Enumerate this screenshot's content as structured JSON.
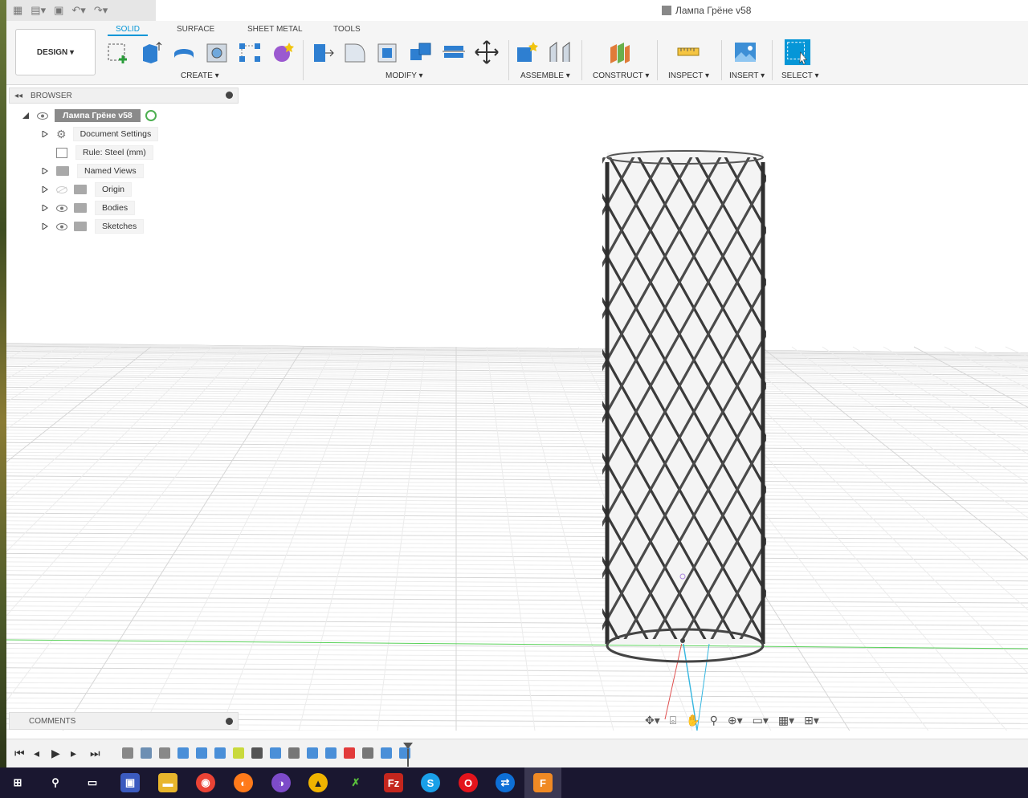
{
  "app": {
    "document_title": "Лампа Грёне v58",
    "workspace_button": "DESIGN ▾"
  },
  "tabs": [
    "SOLID",
    "SURFACE",
    "SHEET METAL",
    "TOOLS"
  ],
  "groups": [
    "CREATE ▾",
    "MODIFY ▾",
    "ASSEMBLE ▾",
    "CONSTRUCT ▾",
    "INSPECT ▾",
    "INSERT ▾",
    "SELECT ▾"
  ],
  "browser": {
    "title": "BROWSER",
    "root": "Лампа Грёне v58",
    "items": [
      "Document Settings",
      "Rule: Steel (mm)",
      "Named Views",
      "Origin",
      "Bodies",
      "Sketches"
    ]
  },
  "comments": {
    "title": "COMMENTS"
  },
  "colors": {
    "accent": "#0696d7",
    "selected_tool": "#e23b3b",
    "taskbar": "#1a1730"
  },
  "taskbar": [
    "windows-start",
    "search",
    "task-view",
    "save-app",
    "file-explorer",
    "chrome",
    "firefox",
    "tor-browser",
    "archiver",
    "git",
    "filezilla",
    "skype",
    "opera",
    "teamviewer",
    "fusion-360"
  ]
}
